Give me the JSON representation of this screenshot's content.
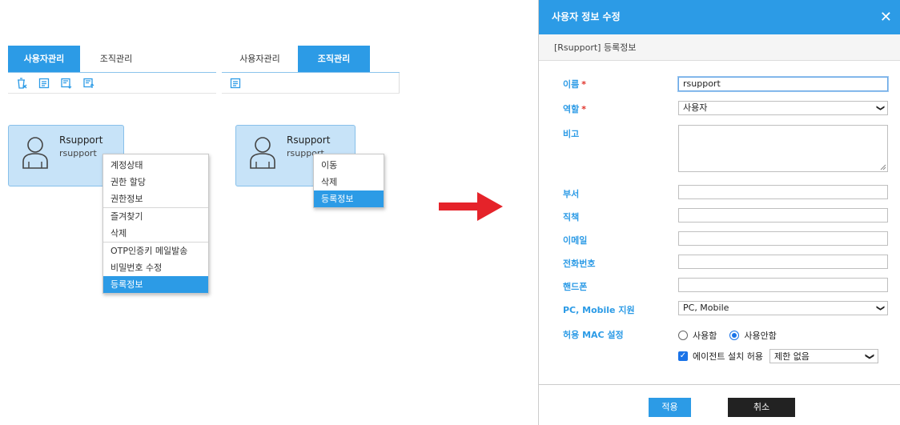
{
  "left_panel": {
    "tabs": [
      {
        "label": "사용자관리",
        "active": true
      },
      {
        "label": "조직관리",
        "active": false
      }
    ],
    "toolbar_icons": [
      "delete-user-icon",
      "memo-icon",
      "import-icon",
      "export-icon"
    ],
    "card": {
      "name": "Rsupport",
      "id": "rsupport"
    },
    "context_menu": [
      [
        "계정상태",
        "권한 할당",
        "권한정보"
      ],
      [
        "즐겨찾기",
        "삭제"
      ],
      [
        "OTP인증키 메일발송",
        "비밀번호 수정",
        "등록정보"
      ]
    ],
    "selected_item": "등록정보"
  },
  "right_panel": {
    "tabs": [
      {
        "label": "사용자관리",
        "active": false
      },
      {
        "label": "조직관리",
        "active": true
      }
    ],
    "toolbar_icons": [
      "memo-icon"
    ],
    "card": {
      "name": "Rsupport",
      "id": "rsupport"
    },
    "context_menu": [
      "이동",
      "삭제",
      "등록정보"
    ],
    "selected_item": "등록정보"
  },
  "dialog": {
    "title": "사용자 정보 수정",
    "close": "✕",
    "subtitle": "[Rsupport] 등록정보",
    "fields": {
      "name_label": "이름",
      "name_value": "rsupport",
      "role_label": "역할",
      "role_value": "사용자",
      "note_label": "비고",
      "dept_label": "부서",
      "position_label": "직책",
      "email_label": "이메일",
      "phone_label": "전화번호",
      "mobile_label": "핸드폰",
      "platform_label": "PC, Mobile 지원",
      "platform_value": "PC, Mobile",
      "mac_label": "허용 MAC 설정",
      "mac_use": "사용함",
      "mac_nouse": "사용안함",
      "agent_label": "에이전트 설치 허용",
      "agent_value": "제한 없음"
    },
    "required_mark": "*",
    "apply_label": "적용",
    "cancel_label": "취소"
  },
  "colors": {
    "accent": "#2c9be6",
    "card_bg": "#c7e3f8",
    "arrow": "#e5232a"
  }
}
